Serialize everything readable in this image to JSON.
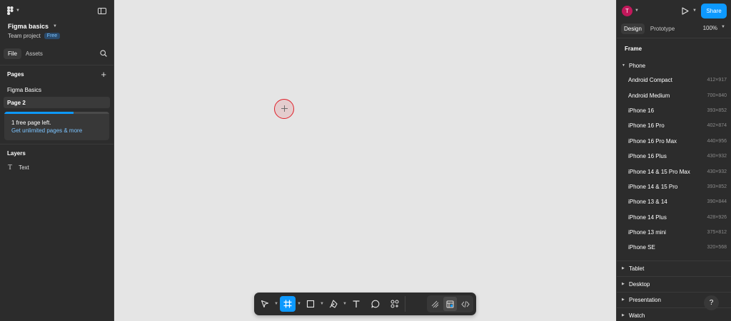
{
  "file": {
    "title": "Figma basics",
    "team": "Team project",
    "plan_badge": "Free"
  },
  "left_tabs": {
    "file": "File",
    "assets": "Assets"
  },
  "pages": {
    "heading": "Pages",
    "items": [
      {
        "label": "Figma Basics",
        "active": false
      },
      {
        "label": "Page 2",
        "active": true
      }
    ],
    "upsell_line1": "1 free page left.",
    "upsell_link": "Get unlimited pages & more",
    "upsell_progress": 0.66
  },
  "layers": {
    "heading": "Layers",
    "items": [
      {
        "label": "Text",
        "type": "text"
      }
    ]
  },
  "header_right": {
    "avatar_initial": "T",
    "avatar_color": "#c2185b",
    "share_label": "Share",
    "share_color": "#0d99ff"
  },
  "right_tabs": {
    "design": "Design",
    "prototype": "Prototype",
    "zoom": "100%"
  },
  "frame_panel": {
    "heading": "Frame",
    "group": "Phone",
    "presets": [
      {
        "name": "Android Compact",
        "size": "412×917"
      },
      {
        "name": "Android Medium",
        "size": "700×840"
      },
      {
        "name": "iPhone 16",
        "size": "393×852"
      },
      {
        "name": "iPhone 16 Pro",
        "size": "402×874"
      },
      {
        "name": "iPhone 16 Pro Max",
        "size": "440×956"
      },
      {
        "name": "iPhone 16 Plus",
        "size": "430×932"
      },
      {
        "name": "iPhone 14 & 15 Pro Max",
        "size": "430×932"
      },
      {
        "name": "iPhone 14 & 15 Pro",
        "size": "393×852"
      },
      {
        "name": "iPhone 13 & 14",
        "size": "390×844"
      },
      {
        "name": "iPhone 14 Plus",
        "size": "428×926"
      },
      {
        "name": "iPhone 13 mini",
        "size": "375×812"
      },
      {
        "name": "iPhone SE",
        "size": "320×568"
      }
    ],
    "categories": [
      "Tablet",
      "Desktop",
      "Presentation",
      "Watch"
    ]
  },
  "help_label": "?",
  "toolbar": {
    "tools": [
      "move-tool",
      "frame-tool",
      "shape-tool",
      "pen-tool",
      "text-tool",
      "comment-tool",
      "actions-tool"
    ],
    "active_tool": "frame-tool",
    "modes": [
      "draw-mode",
      "design-mode",
      "dev-mode"
    ],
    "active_mode": "design-mode"
  }
}
